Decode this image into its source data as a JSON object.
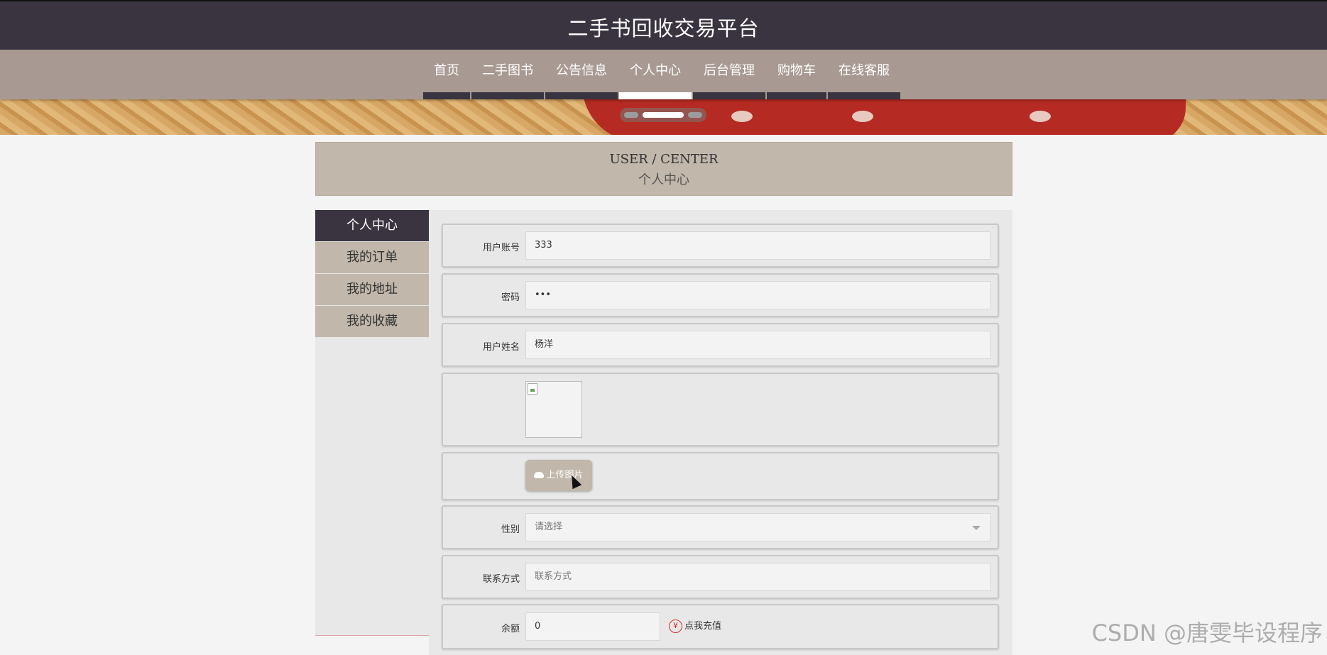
{
  "site": {
    "title": "二手书回收交易平台"
  },
  "nav": {
    "items": [
      {
        "label": "首页",
        "active": false
      },
      {
        "label": "二手图书",
        "active": false
      },
      {
        "label": "公告信息",
        "active": false
      },
      {
        "label": "个人中心",
        "active": true
      },
      {
        "label": "后台管理",
        "active": false
      },
      {
        "label": "购物车",
        "active": false
      },
      {
        "label": "在线客服",
        "active": false
      }
    ]
  },
  "center_header": {
    "en": "USER / CENTER",
    "cn": "个人中心"
  },
  "sidebar": {
    "items": [
      {
        "label": "个人中心",
        "active": true
      },
      {
        "label": "我的订单",
        "active": false
      },
      {
        "label": "我的地址",
        "active": false
      },
      {
        "label": "我的收藏",
        "active": false
      }
    ]
  },
  "form": {
    "account": {
      "label": "用户账号",
      "value": "333"
    },
    "password": {
      "label": "密码",
      "value": "•••"
    },
    "name": {
      "label": "用户姓名",
      "value": "杨洋"
    },
    "upload": {
      "label": "上传图片",
      "icon": "cloud-upload-icon"
    },
    "gender": {
      "label": "性别",
      "placeholder": "请选择"
    },
    "contact": {
      "label": "联系方式",
      "placeholder": "联系方式"
    },
    "balance": {
      "label": "余额",
      "value": "0",
      "recharge_label": "点我充值",
      "recharge_icon": "yen-icon"
    }
  },
  "watermark": "CSDN @唐雯毕设程序",
  "colors": {
    "title_bar": "#3a3440",
    "nav_bar": "#a89a92",
    "accent": "#c1b7aa"
  }
}
